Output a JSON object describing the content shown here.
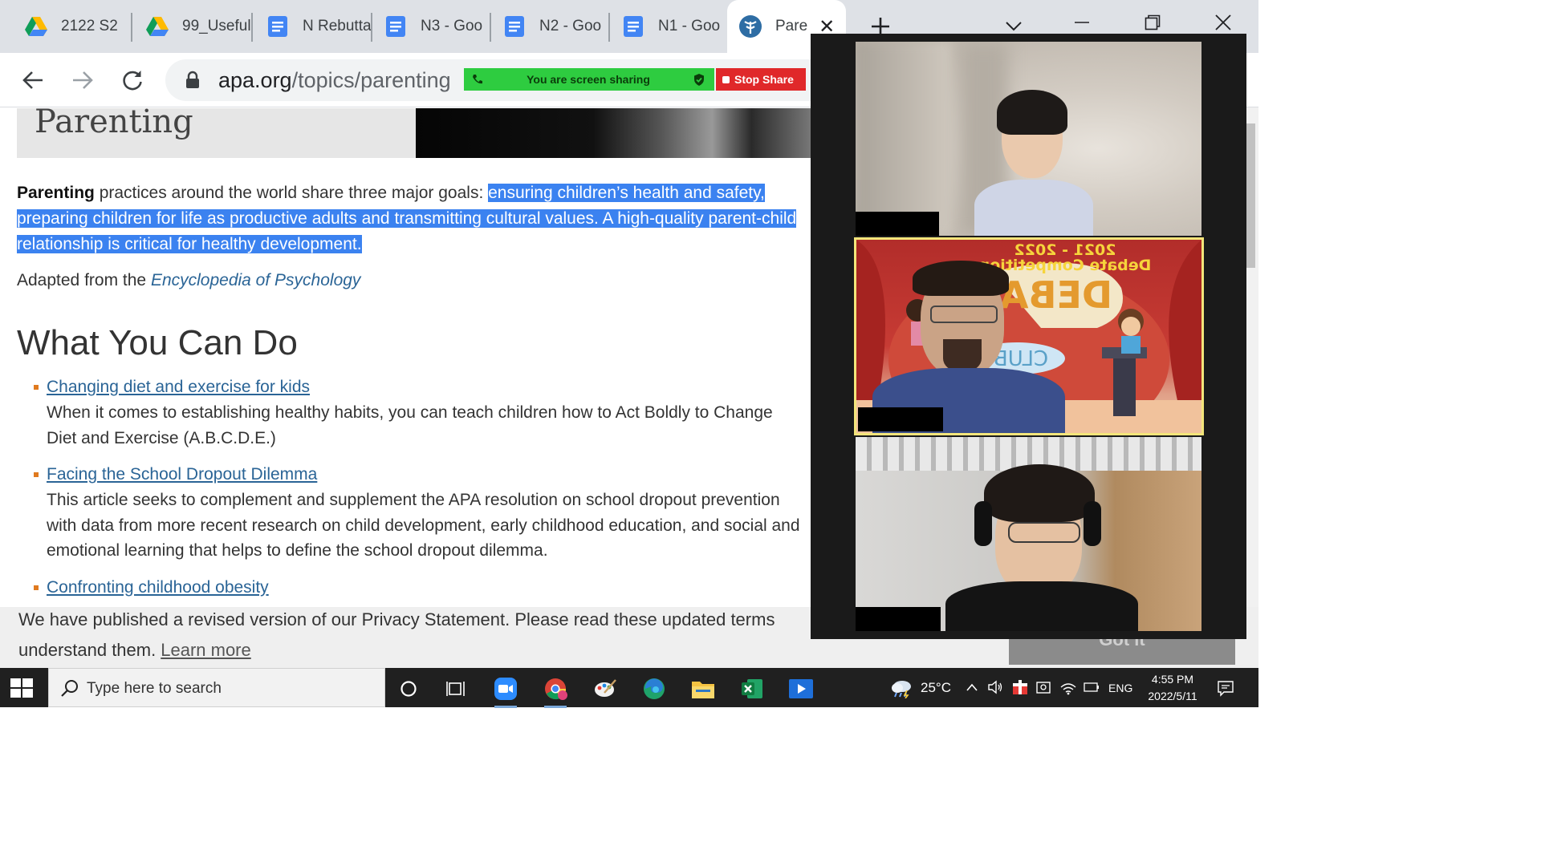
{
  "browser": {
    "tabs": [
      {
        "label": "2122 S2",
        "icon": "google-drive-icon"
      },
      {
        "label": "99_Useful",
        "icon": "google-drive-icon"
      },
      {
        "label": "N Rebuttal",
        "icon": "google-docs-icon"
      },
      {
        "label": "N3 - Goo",
        "icon": "google-docs-icon"
      },
      {
        "label": "N2 - Goo",
        "icon": "google-docs-icon"
      },
      {
        "label": "N1 - Goo",
        "icon": "google-docs-icon"
      },
      {
        "label": "Pare",
        "icon": "apa-icon",
        "active": true
      }
    ],
    "url_domain": "apa.org",
    "url_path": "/topics/parenting"
  },
  "zoom_share": {
    "banner_text": "You are screen sharing",
    "stop_label": "Stop Share"
  },
  "page": {
    "hero_title": "Parenting",
    "intro_bold": "Parenting",
    "intro_plain": " practices around the world share three major goals: ",
    "intro_selected": "ensuring children’s health and safety, preparing children for life as productive adults and transmitting cultural values. A high-quality parent-child relationship is critical for healthy development.",
    "adapted_prefix": "Adapted from the ",
    "adapted_source": "Encyclopedia of Psychology",
    "section_title": "What You Can Do",
    "resources": [
      {
        "title": "Changing diet and exercise for kids",
        "desc": "When it comes to establishing healthy habits, you can teach children how to Act Boldly to Change Diet and Exercise (A.B.C.D.E.)"
      },
      {
        "title": "Facing the School Dropout Dilemma",
        "desc": "This article seeks to complement and supplement the APA resolution on school dropout prevention with data from more recent research on child development, early childhood education, and social and emotional learning that helps to define the school dropout dilemma."
      },
      {
        "title": "Confronting childhood obesity",
        "desc": ""
      }
    ]
  },
  "privacy": {
    "line1": "We have published a revised version of our Privacy Statement. Please read these updated terms",
    "line2": "understand them.",
    "learn_more": "Learn more",
    "button": "Got it"
  },
  "zoom_video": {
    "banner_line1": "2021 - 2022",
    "banner_line2": "Debate Competition",
    "board_text": "DEBA",
    "club_text": "CLUB"
  },
  "taskbar": {
    "search_placeholder": "Type here to search",
    "temperature": "25°C",
    "language": "ENG",
    "time": "4:55 PM",
    "date": "2022/5/11"
  },
  "colors": {
    "selection": "#3b82f0",
    "link": "#2a6496",
    "share_green": "#2ecc40",
    "stop_red": "#e0282a"
  }
}
